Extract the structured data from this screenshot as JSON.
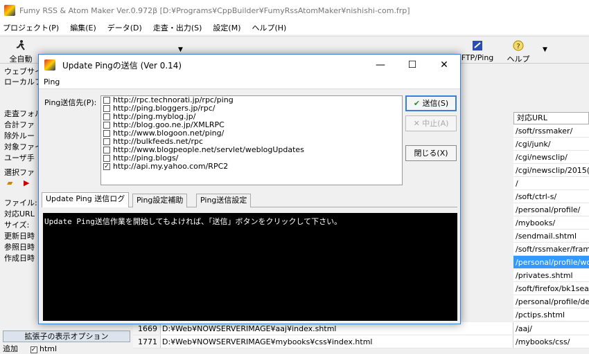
{
  "app": {
    "title": "Fumy RSS & Atom Maker  Ver.0.972β  [D:¥Programs¥CppBuilder¥FumyRssAtomMaker¥nishishi-com.frp]",
    "menu": [
      "プロジェクト(P)",
      "編集(E)",
      "データ(D)",
      "走査・出力(S)",
      "設定(M)",
      "ヘルプ(H)"
    ]
  },
  "toolbar": {
    "all_auto": "全自動",
    "ftp_ping": "FTP/Ping",
    "help": "ヘルプ"
  },
  "left_panel": {
    "lines": [
      "ウェブサイ",
      "ローカルフ",
      "走査フォル",
      "合計ファ",
      "除外ルー",
      "対象ファイ",
      "ユーザ手",
      "選択ファ",
      "ファイル:",
      "対応URL",
      "サイズ:",
      "更新日時",
      "参照日時",
      "作成日時"
    ]
  },
  "ext_options": {
    "header": "拡張子の表示オプション",
    "left_label": "追加",
    "html_label": "html"
  },
  "url_column": {
    "header": "対応URL",
    "rows": [
      "/soft/rssmaker/",
      "/cgi/junk/",
      "/cgi/newsclip/",
      "/cgi/newsclip/2015(",
      "/",
      "/soft/ctrl-s/",
      "/personal/profile/",
      "/mybooks/",
      "/sendmail.shtml",
      "/soft/rssmaker/fram",
      "/personal/profile/wo",
      "/privates.shtml",
      "/soft/firefox/bk1sea",
      "/personal/profile/de",
      "/pctips.shtml",
      "/aaj/"
    ],
    "selected_index": 10
  },
  "bottom_rows": [
    {
      "num": "1669",
      "path": "D:¥Web¥NOWSERVERIMAGE¥aaj¥index.shtml",
      "url": "/aaj/"
    },
    {
      "num": "1771",
      "path": "D:¥Web¥NOWSERVERIMAGE¥mybooks¥css¥index.html",
      "url": "/mybooks/css/"
    }
  ],
  "dialog": {
    "title": "Update Pingの送信  (Ver 0.14)",
    "menu": "Ping",
    "ping_label": "Ping送信先(P):",
    "ping_targets": [
      {
        "url": "http://rpc.technorati.jp/rpc/ping",
        "checked": false
      },
      {
        "url": "http://ping.bloggers.jp/rpc/",
        "checked": false
      },
      {
        "url": "http://ping.myblog.jp/",
        "checked": false
      },
      {
        "url": "http://blog.goo.ne.jp/XMLRPC",
        "checked": false
      },
      {
        "url": "http://www.blogoon.net/ping/",
        "checked": false
      },
      {
        "url": "http://bulkfeeds.net/rpc",
        "checked": false
      },
      {
        "url": "http://www.blogpeople.net/servlet/weblogUpdates",
        "checked": false
      },
      {
        "url": "http://ping.blogs/",
        "checked": false
      },
      {
        "url": "http://api.my.yahoo.com/RPC2",
        "checked": true
      }
    ],
    "buttons": {
      "send": "送信(S)",
      "stop": "中止(A)",
      "close": "閉じる(X)"
    },
    "tabs": [
      "Update Ping 送信ログ",
      "Ping設定補助",
      "Ping送信設定"
    ],
    "log_text": "Update Ping送信作業を開始してもよければ、「送信」ボタンをクリックして下さい。"
  }
}
